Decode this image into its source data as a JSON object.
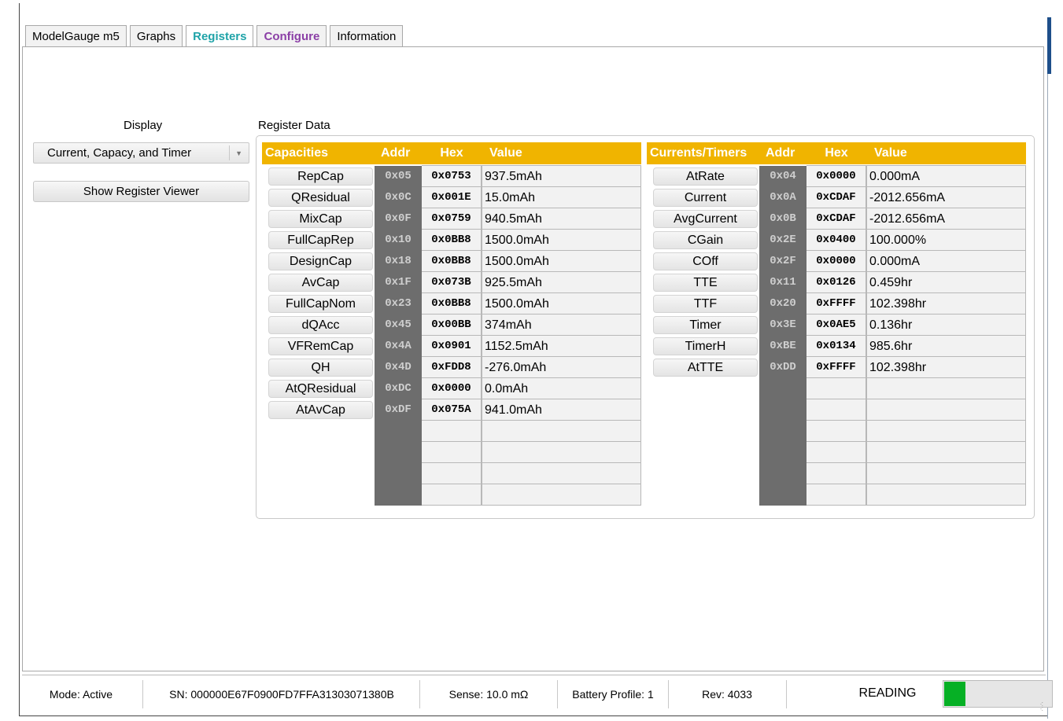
{
  "tabs": [
    {
      "label": "ModelGauge m5"
    },
    {
      "label": "Graphs"
    },
    {
      "label": "Registers"
    },
    {
      "label": "Configure"
    },
    {
      "label": "Information"
    }
  ],
  "display": {
    "label": "Display",
    "selected": "Current, Capacy, and Timer",
    "arrow_icon": "dropdown-arrow-icon"
  },
  "show_register_viewer_label": "Show Register Viewer",
  "register_data_label": "Register Data",
  "colors": {
    "header": "#f0b400",
    "addr_bg": "#6d6d6d",
    "progress": "#06b025",
    "active_tab": "#1fa3a8",
    "configure_tab": "#8b3fa6"
  },
  "capacities": {
    "headers": [
      "Capacities",
      "Addr",
      "Hex",
      "Value"
    ],
    "rows": [
      {
        "name": "RepCap",
        "addr": "0x05",
        "hex": "0x0753",
        "value": "937.5mAh"
      },
      {
        "name": "QResidual",
        "addr": "0x0C",
        "hex": "0x001E",
        "value": "15.0mAh"
      },
      {
        "name": "MixCap",
        "addr": "0x0F",
        "hex": "0x0759",
        "value": "940.5mAh"
      },
      {
        "name": "FullCapRep",
        "addr": "0x10",
        "hex": "0x0BB8",
        "value": "1500.0mAh"
      },
      {
        "name": "DesignCap",
        "addr": "0x18",
        "hex": "0x0BB8",
        "value": "1500.0mAh"
      },
      {
        "name": "AvCap",
        "addr": "0x1F",
        "hex": "0x073B",
        "value": "925.5mAh"
      },
      {
        "name": "FullCapNom",
        "addr": "0x23",
        "hex": "0x0BB8",
        "value": "1500.0mAh"
      },
      {
        "name": "dQAcc",
        "addr": "0x45",
        "hex": "0x00BB",
        "value": "374mAh"
      },
      {
        "name": "VFRemCap",
        "addr": "0x4A",
        "hex": "0x0901",
        "value": "1152.5mAh"
      },
      {
        "name": "QH",
        "addr": "0x4D",
        "hex": "0xFDD8",
        "value": "-276.0mAh"
      },
      {
        "name": "AtQResidual",
        "addr": "0xDC",
        "hex": "0x0000",
        "value": "0.0mAh"
      },
      {
        "name": "AtAvCap",
        "addr": "0xDF",
        "hex": "0x075A",
        "value": "941.0mAh"
      }
    ]
  },
  "currents": {
    "headers": [
      "Currents/Timers",
      "Addr",
      "Hex",
      "Value"
    ],
    "rows": [
      {
        "name": "AtRate",
        "addr": "0x04",
        "hex": "0x0000",
        "value": "0.000mA"
      },
      {
        "name": "Current",
        "addr": "0x0A",
        "hex": "0xCDAF",
        "value": "-2012.656mA"
      },
      {
        "name": "AvgCurrent",
        "addr": "0x0B",
        "hex": "0xCDAF",
        "value": "-2012.656mA"
      },
      {
        "name": "CGain",
        "addr": "0x2E",
        "hex": "0x0400",
        "value": "100.000%"
      },
      {
        "name": "COff",
        "addr": "0x2F",
        "hex": "0x0000",
        "value": "0.000mA"
      },
      {
        "name": "TTE",
        "addr": "0x11",
        "hex": "0x0126",
        "value": "0.459hr"
      },
      {
        "name": "TTF",
        "addr": "0x20",
        "hex": "0xFFFF",
        "value": "102.398hr"
      },
      {
        "name": "Timer",
        "addr": "0x3E",
        "hex": "0x0AE5",
        "value": "0.136hr"
      },
      {
        "name": "TimerH",
        "addr": "0xBE",
        "hex": "0x0134",
        "value": "985.6hr"
      },
      {
        "name": "AtTTE",
        "addr": "0xDD",
        "hex": "0xFFFF",
        "value": "102.398hr"
      }
    ]
  },
  "status_bar": {
    "mode": "Mode: Active",
    "sn": "SN: 000000E67F0900FD7FFA31303071380B",
    "sense": "Sense: 10.0 mΩ",
    "battery_profile": "Battery Profile: 1",
    "rev": "Rev: 4033",
    "reading": "READING",
    "progress": 0.2
  }
}
